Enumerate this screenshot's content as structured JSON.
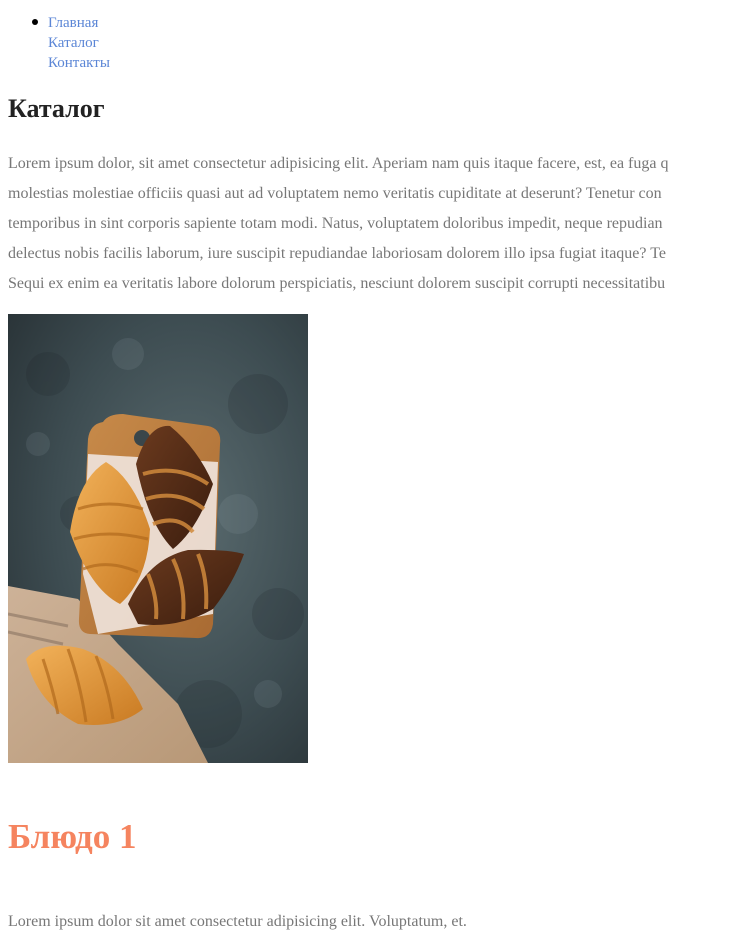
{
  "nav": {
    "items": [
      {
        "label": "Главная"
      },
      {
        "label": "Каталог"
      },
      {
        "label": "Контакты"
      }
    ]
  },
  "page": {
    "title": "Каталог"
  },
  "intro": {
    "lines": [
      "Lorem ipsum dolor, sit amet consectetur adipisicing elit. Aperiam nam quis itaque facere, est, ea fuga q",
      "molestias molestiae officiis quasi aut ad voluptatem nemo veritatis cupiditate at deserunt? Tenetur con",
      "temporibus in sint corporis sapiente totam modi. Natus, voluptatem doloribus impedit, neque repudian",
      "delectus nobis facilis laborum, iure suscipit repudiandae laboriosam dolorem illo ipsa fugiat itaque? Te",
      "Sequi ex enim ea veritatis labore dolorum perspiciatis, nesciunt dolorem suscipit corrupti necessitatibu"
    ]
  },
  "dish": {
    "title": "Блюдо 1",
    "description": "Lorem ipsum dolor sit amet consectetur adipisicing elit. Voluptatum, et."
  },
  "colors": {
    "link": "#5b86d6",
    "heading": "#222222",
    "text": "#777777",
    "accent": "#f5845f"
  }
}
